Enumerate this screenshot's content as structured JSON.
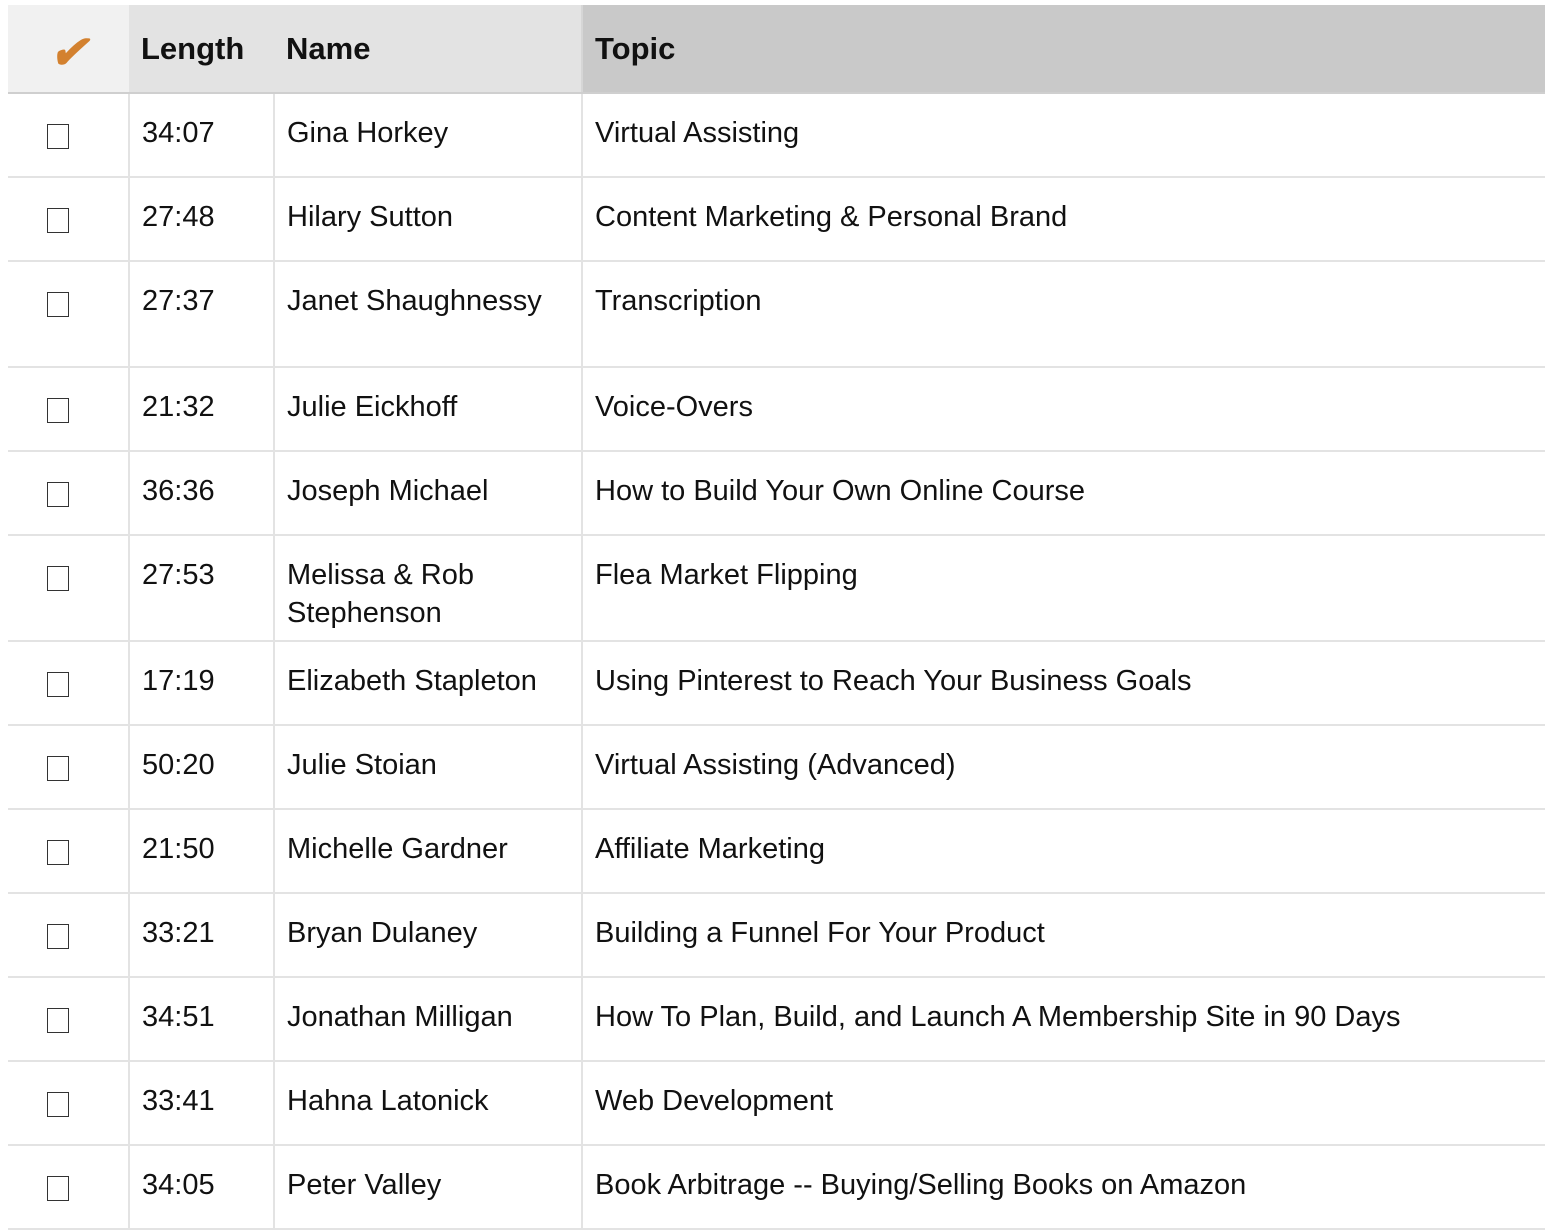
{
  "header": {
    "check_glyph": "✔",
    "check_color": "#d3812f",
    "length_label": "Length",
    "name_label": "Name",
    "topic_label": "Topic"
  },
  "rows": [
    {
      "length": "34:07",
      "name": "Gina Horkey",
      "topic": "Virtual Assisting",
      "checked": false
    },
    {
      "length": "27:48",
      "name": "Hilary Sutton",
      "topic": "Content Marketing & Personal Brand",
      "checked": false
    },
    {
      "length": "27:37",
      "name": "Janet Shaughnessy",
      "topic": "Transcription",
      "checked": false
    },
    {
      "length": "21:32",
      "name": "Julie Eickhoff",
      "topic": "Voice-Overs",
      "checked": false
    },
    {
      "length": "36:36",
      "name": "Joseph Michael",
      "topic": "How to Build Your Own Online Course",
      "checked": false
    },
    {
      "length": "27:53",
      "name": "Melissa & Rob Stephenson",
      "topic": "Flea Market Flipping",
      "checked": false
    },
    {
      "length": "17:19",
      "name": "Elizabeth Stapleton",
      "topic": "Using Pinterest to Reach Your Business Goals",
      "checked": false
    },
    {
      "length": "50:20",
      "name": "Julie Stoian",
      "topic": "Virtual Assisting (Advanced)",
      "checked": false
    },
    {
      "length": "21:50",
      "name": "Michelle Gardner",
      "topic": "Affiliate Marketing",
      "checked": false
    },
    {
      "length": "33:21",
      "name": "Bryan Dulaney",
      "topic": "Building a Funnel For Your Product",
      "checked": false
    },
    {
      "length": "34:51",
      "name": "Jonathan Milligan",
      "topic": "How To Plan, Build, and Launch A Membership Site in 90 Days",
      "checked": false
    },
    {
      "length": "33:41",
      "name": "Hahna Latonick",
      "topic": "Web Development",
      "checked": false
    },
    {
      "length": "34:05",
      "name": "Peter Valley",
      "topic": "Book Arbitrage -- Buying/Selling Books on Amazon",
      "checked": false
    }
  ]
}
